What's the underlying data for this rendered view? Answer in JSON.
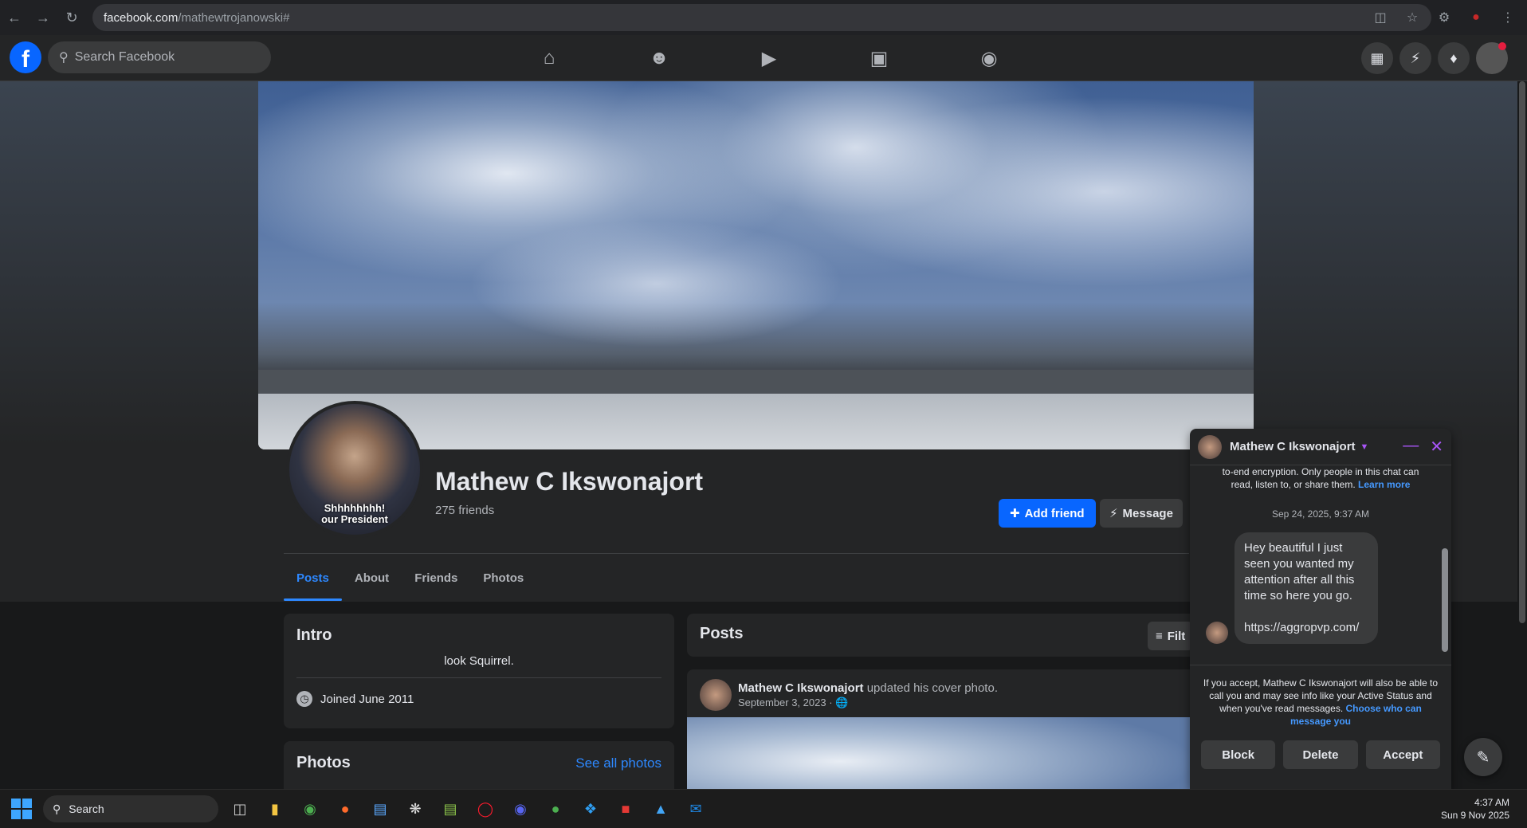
{
  "browser": {
    "url_host": "facebook.com",
    "url_path": "/mathewtrojanowski#",
    "nav": [
      "back-icon",
      "forward-icon",
      "reload-icon"
    ],
    "right_icons": [
      "install-icon",
      "star-icon",
      "extensions-icon",
      "profile-icon",
      "menu-icon"
    ]
  },
  "fb": {
    "logo": "f",
    "search_placeholder": "Search Facebook",
    "center_tabs": [
      "home-icon",
      "friends-icon",
      "video-icon",
      "marketplace-icon",
      "groups-icon"
    ],
    "right_buttons": [
      "menu-grid-icon",
      "messenger-icon",
      "notifications-icon",
      "account-icon"
    ]
  },
  "profile": {
    "name": "Mathew C Ikswonajort",
    "friends": "275 friends",
    "picture_caption": "Shhhhhhhh!\nour President",
    "add_friend": "Add friend",
    "message": "Message",
    "tabs": [
      "Posts",
      "About",
      "Friends",
      "Photos"
    ]
  },
  "intro": {
    "title": "Intro",
    "bio": "look Squirrel.",
    "joined": "Joined June 2011"
  },
  "photos": {
    "title": "Photos",
    "see_all": "See all photos"
  },
  "posts": {
    "title": "Posts",
    "filter": "Filt",
    "post": {
      "author": "Mathew C Ikswonajort",
      "action": "updated his cover photo.",
      "date": "September 3, 2023 ·"
    }
  },
  "chat": {
    "name": "Mathew C Ikswonajort",
    "encryption_text": "to-end encryption. Only people in this chat can read, listen to, or share them.",
    "learn_more": "Learn more",
    "timestamp": "Sep 24, 2025, 9:37 AM",
    "message": "Hey beautiful I just seen you wanted my attention after all this time so here you go.\n\nhttps://aggropvp.com/",
    "notice": "If you accept, Mathew C Ikswonajort will also be able to call you and may see info like your Active Status and when you've read messages.",
    "notice_link": "Choose who can message you",
    "actions": [
      "Block",
      "Delete",
      "Accept"
    ]
  },
  "taskbar": {
    "search": "Search",
    "time": "4:37 AM",
    "date": "Sun 9 Nov 2025"
  }
}
